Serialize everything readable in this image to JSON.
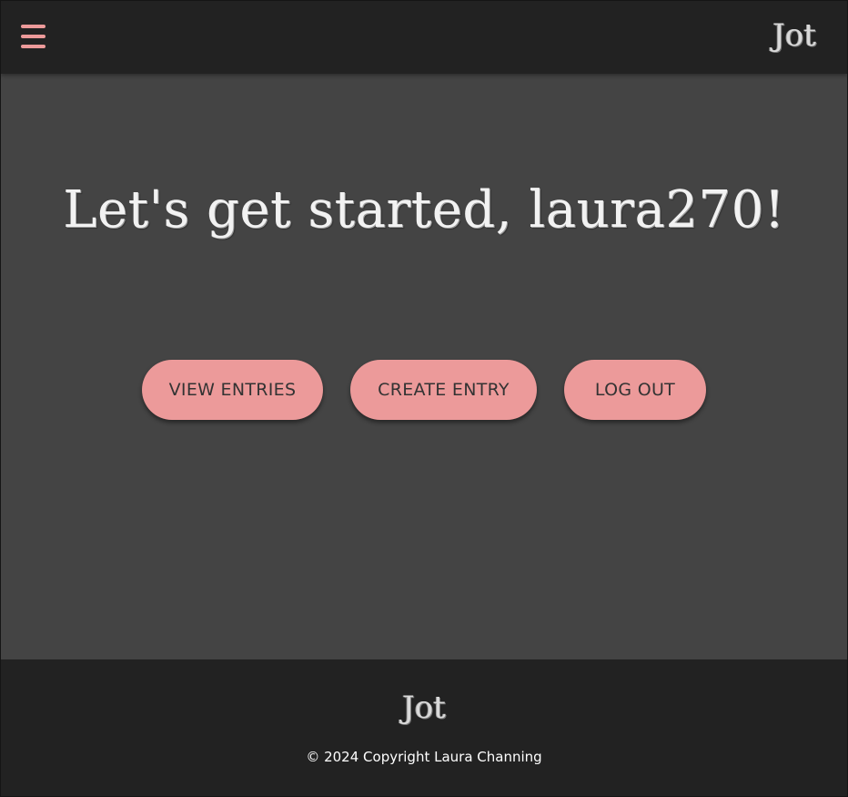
{
  "app": {
    "brand": "Jot"
  },
  "header": {
    "menu_icon": "hamburger-menu-icon",
    "brand": "Jot"
  },
  "main": {
    "greeting": "Let's get started, laura270!",
    "buttons": {
      "view_entries": "VIEW ENTRIES",
      "create_entry": "CREATE ENTRY",
      "log_out": "LOG OUT"
    }
  },
  "footer": {
    "brand": "Jot",
    "copyright": "© 2024 Copyright Laura Channing"
  },
  "colors": {
    "accent": "#ec9a9a",
    "header_bg": "#222222",
    "main_bg": "#444444",
    "footer_bg": "#222222",
    "button_text": "#333333"
  }
}
